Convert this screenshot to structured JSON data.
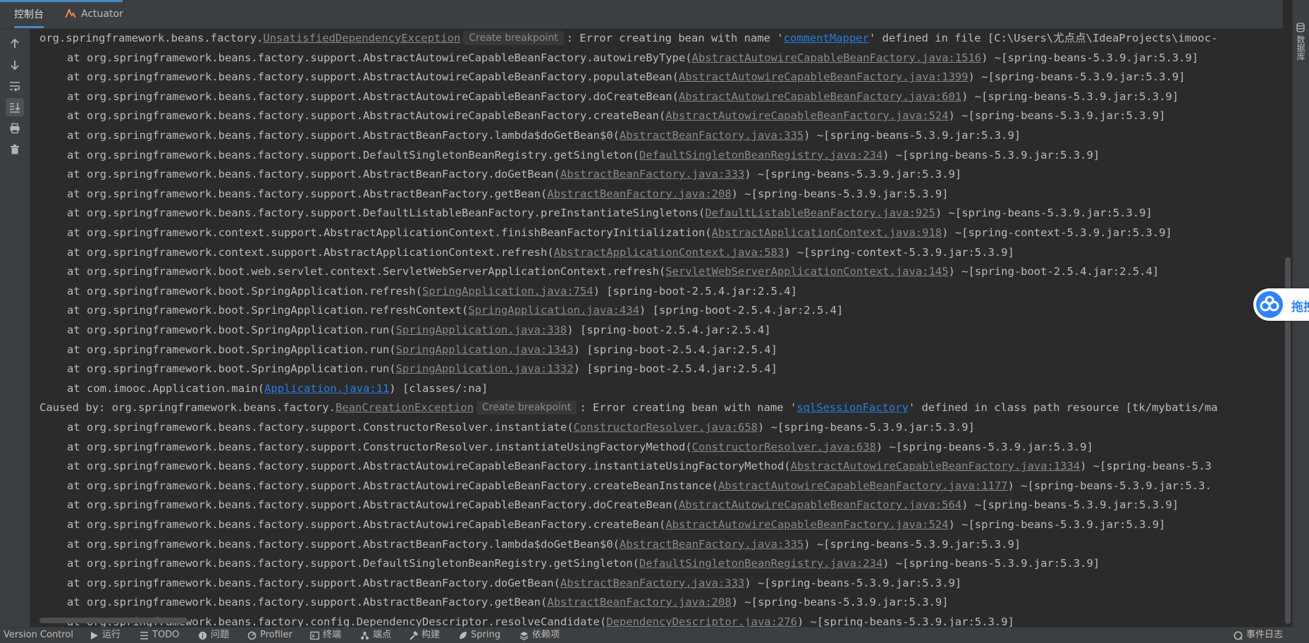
{
  "tabs": [
    {
      "label": "控制台",
      "active": true
    },
    {
      "label": "Actuator",
      "active": false
    }
  ],
  "right_strip": {
    "label": "数据库"
  },
  "cloud_widget": {
    "label": "拖拽"
  },
  "status_bar": {
    "items": [
      "Version Control",
      "运行",
      "TODO",
      "问题",
      "Profiler",
      "终端",
      "端点",
      "构建",
      "Spring",
      "依赖项"
    ],
    "right": "事件日志"
  },
  "console": {
    "lines": [
      {
        "indent": false,
        "segments": [
          {
            "t": "org.springframework.beans.factory."
          },
          {
            "t": "UnsatisfiedDependencyException",
            "link": true
          },
          {
            "t": "Create breakpoint",
            "badge": true
          },
          {
            "t": ": Error creating bean with name '"
          },
          {
            "t": "commentMapper",
            "link": true,
            "blue": true
          },
          {
            "t": "' defined in file [C:\\Users\\尤点点\\IdeaProjects\\imooc-"
          }
        ]
      },
      {
        "indent": true,
        "segments": [
          {
            "t": "at org.springframework.beans.factory.support.AbstractAutowireCapableBeanFactory.autowireByType("
          },
          {
            "t": "AbstractAutowireCapableBeanFactory.java:1516",
            "link": true
          },
          {
            "t": ") ~[spring-beans-5.3.9.jar:5.3.9]"
          }
        ]
      },
      {
        "indent": true,
        "segments": [
          {
            "t": "at org.springframework.beans.factory.support.AbstractAutowireCapableBeanFactory.populateBean("
          },
          {
            "t": "AbstractAutowireCapableBeanFactory.java:1399",
            "link": true
          },
          {
            "t": ") ~[spring-beans-5.3.9.jar:5.3.9]"
          }
        ]
      },
      {
        "indent": true,
        "segments": [
          {
            "t": "at org.springframework.beans.factory.support.AbstractAutowireCapableBeanFactory.doCreateBean("
          },
          {
            "t": "AbstractAutowireCapableBeanFactory.java:601",
            "link": true
          },
          {
            "t": ") ~[spring-beans-5.3.9.jar:5.3.9]"
          }
        ]
      },
      {
        "indent": true,
        "segments": [
          {
            "t": "at org.springframework.beans.factory.support.AbstractAutowireCapableBeanFactory.createBean("
          },
          {
            "t": "AbstractAutowireCapableBeanFactory.java:524",
            "link": true
          },
          {
            "t": ") ~[spring-beans-5.3.9.jar:5.3.9]"
          }
        ]
      },
      {
        "indent": true,
        "segments": [
          {
            "t": "at org.springframework.beans.factory.support.AbstractBeanFactory.lambda$doGetBean$0("
          },
          {
            "t": "AbstractBeanFactory.java:335",
            "link": true
          },
          {
            "t": ") ~[spring-beans-5.3.9.jar:5.3.9]"
          }
        ]
      },
      {
        "indent": true,
        "segments": [
          {
            "t": "at org.springframework.beans.factory.support.DefaultSingletonBeanRegistry.getSingleton("
          },
          {
            "t": "DefaultSingletonBeanRegistry.java:234",
            "link": true
          },
          {
            "t": ") ~[spring-beans-5.3.9.jar:5.3.9]"
          }
        ]
      },
      {
        "indent": true,
        "segments": [
          {
            "t": "at org.springframework.beans.factory.support.AbstractBeanFactory.doGetBean("
          },
          {
            "t": "AbstractBeanFactory.java:333",
            "link": true
          },
          {
            "t": ") ~[spring-beans-5.3.9.jar:5.3.9]"
          }
        ]
      },
      {
        "indent": true,
        "segments": [
          {
            "t": "at org.springframework.beans.factory.support.AbstractBeanFactory.getBean("
          },
          {
            "t": "AbstractBeanFactory.java:208",
            "link": true
          },
          {
            "t": ") ~[spring-beans-5.3.9.jar:5.3.9]"
          }
        ]
      },
      {
        "indent": true,
        "segments": [
          {
            "t": "at org.springframework.beans.factory.support.DefaultListableBeanFactory.preInstantiateSingletons("
          },
          {
            "t": "DefaultListableBeanFactory.java:925",
            "link": true
          },
          {
            "t": ") ~[spring-beans-5.3.9.jar:5.3.9]"
          }
        ]
      },
      {
        "indent": true,
        "segments": [
          {
            "t": "at org.springframework.context.support.AbstractApplicationContext.finishBeanFactoryInitialization("
          },
          {
            "t": "AbstractApplicationContext.java:918",
            "link": true
          },
          {
            "t": ") ~[spring-context-5.3.9.jar:5.3.9]"
          }
        ]
      },
      {
        "indent": true,
        "segments": [
          {
            "t": "at org.springframework.context.support.AbstractApplicationContext.refresh("
          },
          {
            "t": "AbstractApplicationContext.java:583",
            "link": true
          },
          {
            "t": ") ~[spring-context-5.3.9.jar:5.3.9]"
          }
        ]
      },
      {
        "indent": true,
        "segments": [
          {
            "t": "at org.springframework.boot.web.servlet.context.ServletWebServerApplicationContext.refresh("
          },
          {
            "t": "ServletWebServerApplicationContext.java:145",
            "link": true
          },
          {
            "t": ") ~[spring-boot-2.5.4.jar:2.5.4]"
          }
        ]
      },
      {
        "indent": true,
        "segments": [
          {
            "t": "at org.springframework.boot.SpringApplication.refresh("
          },
          {
            "t": "SpringApplication.java:754",
            "link": true
          },
          {
            "t": ") [spring-boot-2.5.4.jar:2.5.4]"
          }
        ]
      },
      {
        "indent": true,
        "segments": [
          {
            "t": "at org.springframework.boot.SpringApplication.refreshContext("
          },
          {
            "t": "SpringApplication.java:434",
            "link": true
          },
          {
            "t": ") [spring-boot-2.5.4.jar:2.5.4]"
          }
        ]
      },
      {
        "indent": true,
        "segments": [
          {
            "t": "at org.springframework.boot.SpringApplication.run("
          },
          {
            "t": "SpringApplication.java:338",
            "link": true
          },
          {
            "t": ") [spring-boot-2.5.4.jar:2.5.4]"
          }
        ]
      },
      {
        "indent": true,
        "segments": [
          {
            "t": "at org.springframework.boot.SpringApplication.run("
          },
          {
            "t": "SpringApplication.java:1343",
            "link": true
          },
          {
            "t": ") [spring-boot-2.5.4.jar:2.5.4]"
          }
        ]
      },
      {
        "indent": true,
        "segments": [
          {
            "t": "at org.springframework.boot.SpringApplication.run("
          },
          {
            "t": "SpringApplication.java:1332",
            "link": true
          },
          {
            "t": ") [spring-boot-2.5.4.jar:2.5.4]"
          }
        ]
      },
      {
        "indent": true,
        "segments": [
          {
            "t": "at com.imooc.Application.main("
          },
          {
            "t": "Application.java:11",
            "link": true,
            "blue": true
          },
          {
            "t": ") [classes/:na]"
          }
        ]
      },
      {
        "indent": false,
        "segments": [
          {
            "t": "Caused by: org.springframework.beans.factory."
          },
          {
            "t": "BeanCreationException",
            "link": true
          },
          {
            "t": "Create breakpoint",
            "badge": true
          },
          {
            "t": ": Error creating bean with name '"
          },
          {
            "t": "sqlSessionFactory",
            "link": true,
            "blue": true
          },
          {
            "t": "' defined in class path resource [tk/mybatis/ma"
          }
        ]
      },
      {
        "indent": true,
        "segments": [
          {
            "t": "at org.springframework.beans.factory.support.ConstructorResolver.instantiate("
          },
          {
            "t": "ConstructorResolver.java:658",
            "link": true
          },
          {
            "t": ") ~[spring-beans-5.3.9.jar:5.3.9]"
          }
        ]
      },
      {
        "indent": true,
        "segments": [
          {
            "t": "at org.springframework.beans.factory.support.ConstructorResolver.instantiateUsingFactoryMethod("
          },
          {
            "t": "ConstructorResolver.java:638",
            "link": true
          },
          {
            "t": ") ~[spring-beans-5.3.9.jar:5.3.9]"
          }
        ]
      },
      {
        "indent": true,
        "segments": [
          {
            "t": "at org.springframework.beans.factory.support.AbstractAutowireCapableBeanFactory.instantiateUsingFactoryMethod("
          },
          {
            "t": "AbstractAutowireCapableBeanFactory.java:1334",
            "link": true
          },
          {
            "t": ") ~[spring-beans-5.3"
          }
        ]
      },
      {
        "indent": true,
        "segments": [
          {
            "t": "at org.springframework.beans.factory.support.AbstractAutowireCapableBeanFactory.createBeanInstance("
          },
          {
            "t": "AbstractAutowireCapableBeanFactory.java:1177",
            "link": true
          },
          {
            "t": ") ~[spring-beans-5.3.9.jar:5.3."
          }
        ]
      },
      {
        "indent": true,
        "segments": [
          {
            "t": "at org.springframework.beans.factory.support.AbstractAutowireCapableBeanFactory.doCreateBean("
          },
          {
            "t": "AbstractAutowireCapableBeanFactory.java:564",
            "link": true
          },
          {
            "t": ") ~[spring-beans-5.3.9.jar:5.3.9]"
          }
        ]
      },
      {
        "indent": true,
        "segments": [
          {
            "t": "at org.springframework.beans.factory.support.AbstractAutowireCapableBeanFactory.createBean("
          },
          {
            "t": "AbstractAutowireCapableBeanFactory.java:524",
            "link": true
          },
          {
            "t": ") ~[spring-beans-5.3.9.jar:5.3.9]"
          }
        ]
      },
      {
        "indent": true,
        "segments": [
          {
            "t": "at org.springframework.beans.factory.support.AbstractBeanFactory.lambda$doGetBean$0("
          },
          {
            "t": "AbstractBeanFactory.java:335",
            "link": true
          },
          {
            "t": ") ~[spring-beans-5.3.9.jar:5.3.9]"
          }
        ]
      },
      {
        "indent": true,
        "segments": [
          {
            "t": "at org.springframework.beans.factory.support.DefaultSingletonBeanRegistry.getSingleton("
          },
          {
            "t": "DefaultSingletonBeanRegistry.java:234",
            "link": true
          },
          {
            "t": ") ~[spring-beans-5.3.9.jar:5.3.9]"
          }
        ]
      },
      {
        "indent": true,
        "segments": [
          {
            "t": "at org.springframework.beans.factory.support.AbstractBeanFactory.doGetBean("
          },
          {
            "t": "AbstractBeanFactory.java:333",
            "link": true
          },
          {
            "t": ") ~[spring-beans-5.3.9.jar:5.3.9]"
          }
        ]
      },
      {
        "indent": true,
        "segments": [
          {
            "t": "at org.springframework.beans.factory.support.AbstractBeanFactory.getBean("
          },
          {
            "t": "AbstractBeanFactory.java:208",
            "link": true
          },
          {
            "t": ") ~[spring-beans-5.3.9.jar:5.3.9]"
          }
        ]
      },
      {
        "indent": true,
        "segments": [
          {
            "t": "at org.springframework.beans.factory.config.DependencyDescriptor.resolveCandidate("
          },
          {
            "t": "DependencyDescriptor.java:276",
            "link": true
          },
          {
            "t": ") ~[spring-beans-5.3.9.jar:5.3.9]"
          }
        ]
      }
    ]
  }
}
